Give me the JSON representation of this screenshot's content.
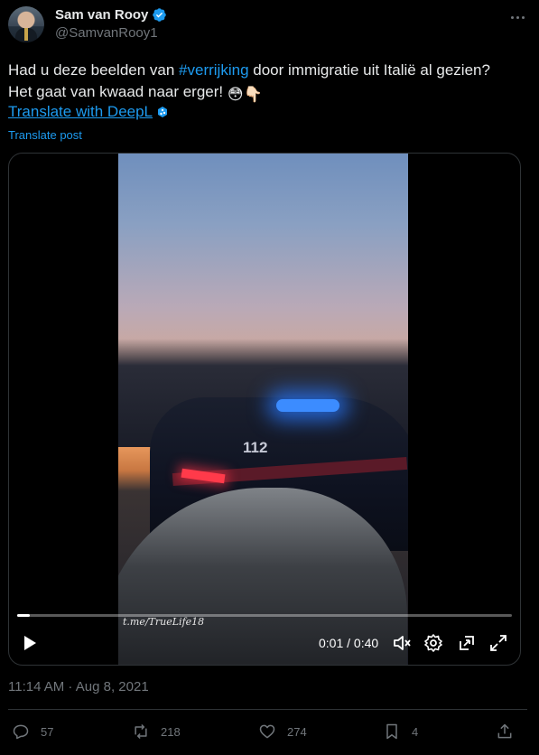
{
  "author": {
    "name": "Sam van Rooy",
    "handle": "@SamvanRooy1"
  },
  "post": {
    "text_line1_pre": "Had u deze beelden van ",
    "hashtag": "#verrijking",
    "text_line1_post": " door immigratie uit Italië al gezien?",
    "text_line2": "Het gaat van kwaad naar erger! ",
    "emoji": "😳👇🏻",
    "deepl_label": "Translate with DeepL",
    "translate_label": "Translate post"
  },
  "video": {
    "car_number": "112",
    "watermark": "t.me/TrueLife18",
    "current_time": "0:01",
    "duration": "0:40",
    "time_display": "0:01 / 0:40",
    "progress_fraction": 0.025
  },
  "timestamp": "11:14 AM · Aug 8, 2021",
  "metrics": {
    "replies": "57",
    "reposts": "218",
    "likes": "274",
    "bookmarks": "4"
  },
  "colors": {
    "accent": "#1d9bf0",
    "muted": "#71767b",
    "text": "#e7e9ea",
    "background": "#000000",
    "border": "#2f3336"
  },
  "icons": [
    "verified-badge-icon",
    "more-icon",
    "deepl-icon",
    "play-icon",
    "mute-icon",
    "settings-icon",
    "pip-icon",
    "fullscreen-icon",
    "reply-icon",
    "repost-icon",
    "like-icon",
    "bookmark-icon",
    "share-icon"
  ]
}
